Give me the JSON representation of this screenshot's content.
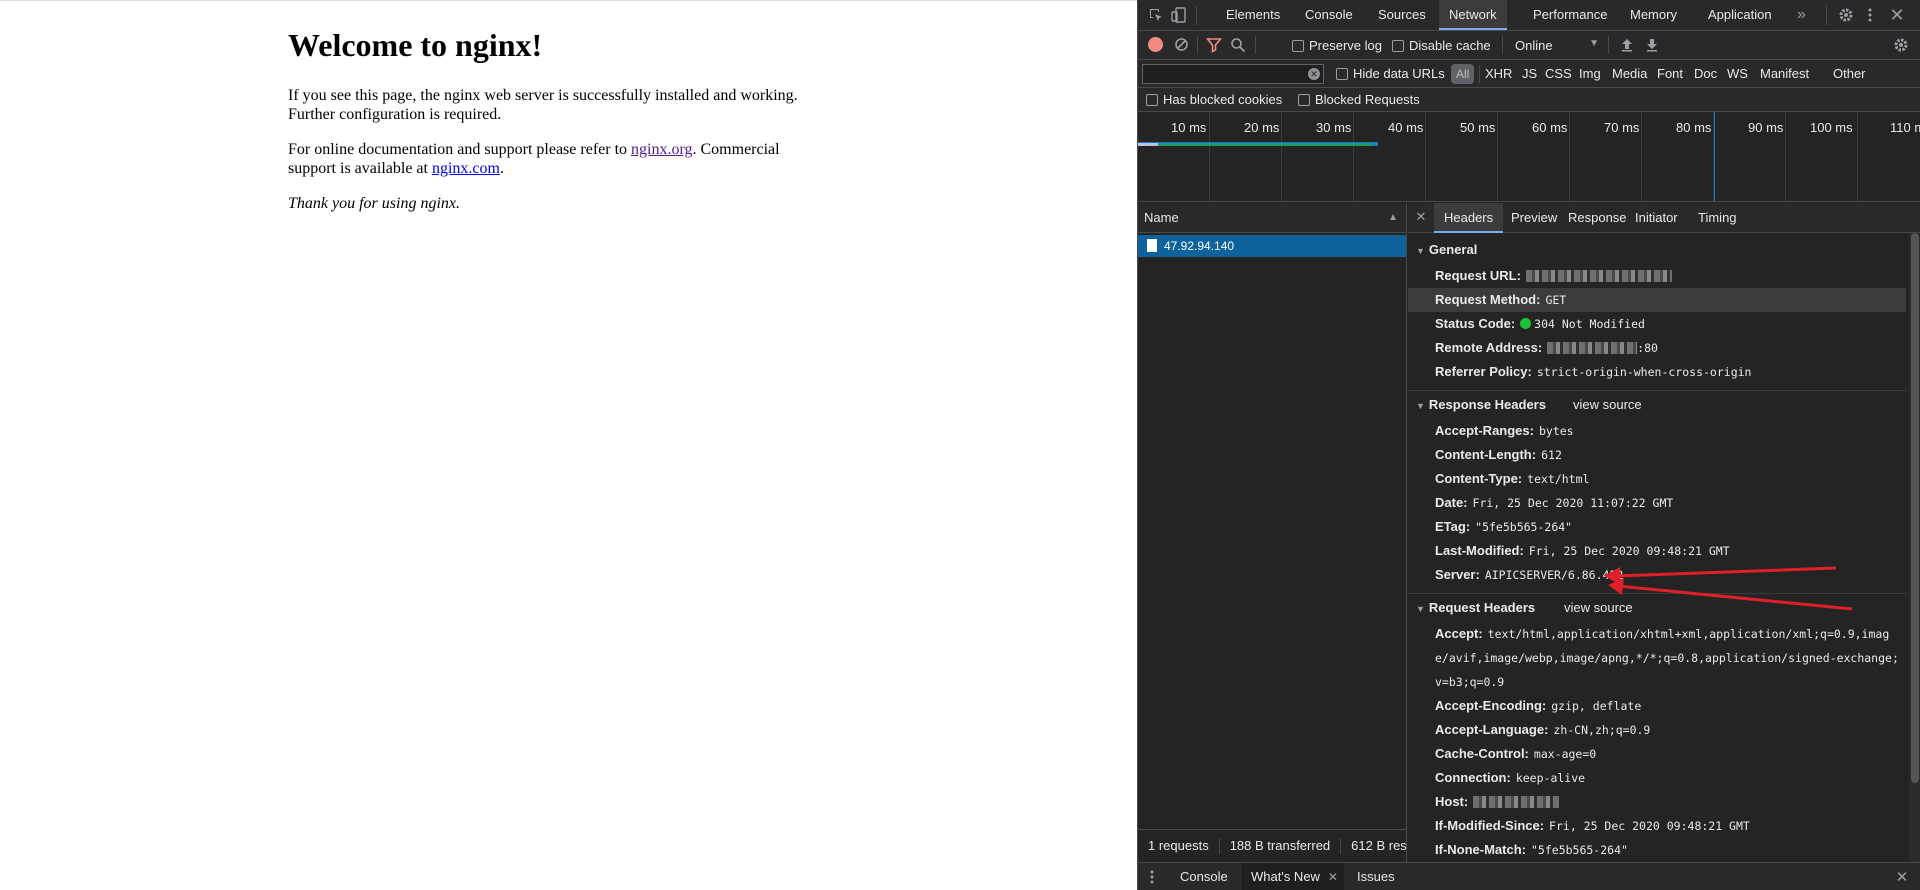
{
  "page": {
    "heading": "Welcome to nginx!",
    "p1": "If you see this page, the nginx web server is successfully installed and working. Further configuration is required.",
    "p2_before": "For online documentation and support please refer to ",
    "p2_link1": "nginx.org",
    "p2_mid": ". Commercial support is available at ",
    "p2_link2": "nginx.com",
    "p2_after": ".",
    "p3": "Thank you for using nginx."
  },
  "devtools": {
    "tabs": [
      "Elements",
      "Console",
      "Sources",
      "Network",
      "Performance",
      "Memory",
      "Application"
    ],
    "active_tab": "Network",
    "more_tabs": "»",
    "toolbar": {
      "preserve_log": "Preserve log",
      "disable_cache": "Disable cache",
      "throttle": "Online"
    },
    "filter": {
      "hide_data_urls": "Hide data URLs",
      "all": "All",
      "types": [
        "XHR",
        "JS",
        "CSS",
        "Img",
        "Media",
        "Font",
        "Doc",
        "WS",
        "Manifest",
        "Other"
      ],
      "has_blocked_cookies": "Has blocked cookies",
      "blocked_requests": "Blocked Requests"
    },
    "timeline_ticks": [
      "10 ms",
      "20 ms",
      "30 ms",
      "40 ms",
      "50 ms",
      "60 ms",
      "70 ms",
      "80 ms",
      "90 ms",
      "100 ms",
      "110 m"
    ],
    "request_list": {
      "column": "Name",
      "sort_icon": "▲",
      "rows": [
        "47.92.94.140"
      ]
    },
    "status": {
      "requests": "1 requests",
      "transferred": "188 B transferred",
      "resources": "612 B res"
    },
    "detail_tabs": [
      "Headers",
      "Preview",
      "Response",
      "Initiator",
      "Timing"
    ],
    "active_detail_tab": "Headers",
    "general": {
      "title": "General",
      "request_url_label": "Request URL:",
      "request_method_label": "Request Method:",
      "request_method": "GET",
      "status_code_label": "Status Code:",
      "status_code": "304 Not Modified",
      "remote_address_label": "Remote Address:",
      "remote_address_suffix": ":80",
      "referrer_policy_label": "Referrer Policy:",
      "referrer_policy": "strict-origin-when-cross-origin"
    },
    "response_headers": {
      "title": "Response Headers",
      "view_source": "view source",
      "rows": [
        {
          "name": "Accept-Ranges:",
          "value": "bytes"
        },
        {
          "name": "Content-Length:",
          "value": "612"
        },
        {
          "name": "Content-Type:",
          "value": "text/html"
        },
        {
          "name": "Date:",
          "value": "Fri, 25 Dec 2020 11:07:22 GMT"
        },
        {
          "name": "ETag:",
          "value": "\"5fe5b565-264\""
        },
        {
          "name": "Last-Modified:",
          "value": "Fri, 25 Dec 2020 09:48:21 GMT"
        },
        {
          "name": "Server:",
          "value": "AIPICSERVER/6.86.452"
        }
      ]
    },
    "request_headers": {
      "title": "Request Headers",
      "view_source": "view source",
      "accept_label": "Accept:",
      "accept": "text/html,application/xhtml+xml,application/xml;q=0.9,image/avif,image/webp,image/apng,*/*;q=0.8,application/signed-exchange;v=b3;q=0.9",
      "rows": [
        {
          "name": "Accept-Encoding:",
          "value": "gzip, deflate"
        },
        {
          "name": "Accept-Language:",
          "value": "zh-CN,zh;q=0.9"
        },
        {
          "name": "Cache-Control:",
          "value": "max-age=0"
        },
        {
          "name": "Connection:",
          "value": "keep-alive"
        }
      ],
      "host_label": "Host:",
      "rows2": [
        {
          "name": "If-Modified-Since:",
          "value": "Fri, 25 Dec 2020 09:48:21 GMT"
        },
        {
          "name": "If-None-Match:",
          "value": "\"5fe5b565-264\""
        }
      ]
    },
    "drawer": {
      "tabs": [
        "Console",
        "What's New",
        "Issues"
      ],
      "active": "What's New"
    },
    "colors": {
      "accent": "#7cacf8",
      "selected_row": "#0e639c",
      "record": "#f28b82",
      "status_ok": "#18c33a",
      "annotation_arrow": "#e0202a"
    },
    "icons": [
      "inspect-icon",
      "device-toggle-icon",
      "settings-icon",
      "kebab-menu-icon",
      "close-icon",
      "record-icon",
      "clear-icon",
      "filter-icon",
      "search-icon",
      "upload-icon",
      "download-icon",
      "clear-filter-icon"
    ]
  }
}
